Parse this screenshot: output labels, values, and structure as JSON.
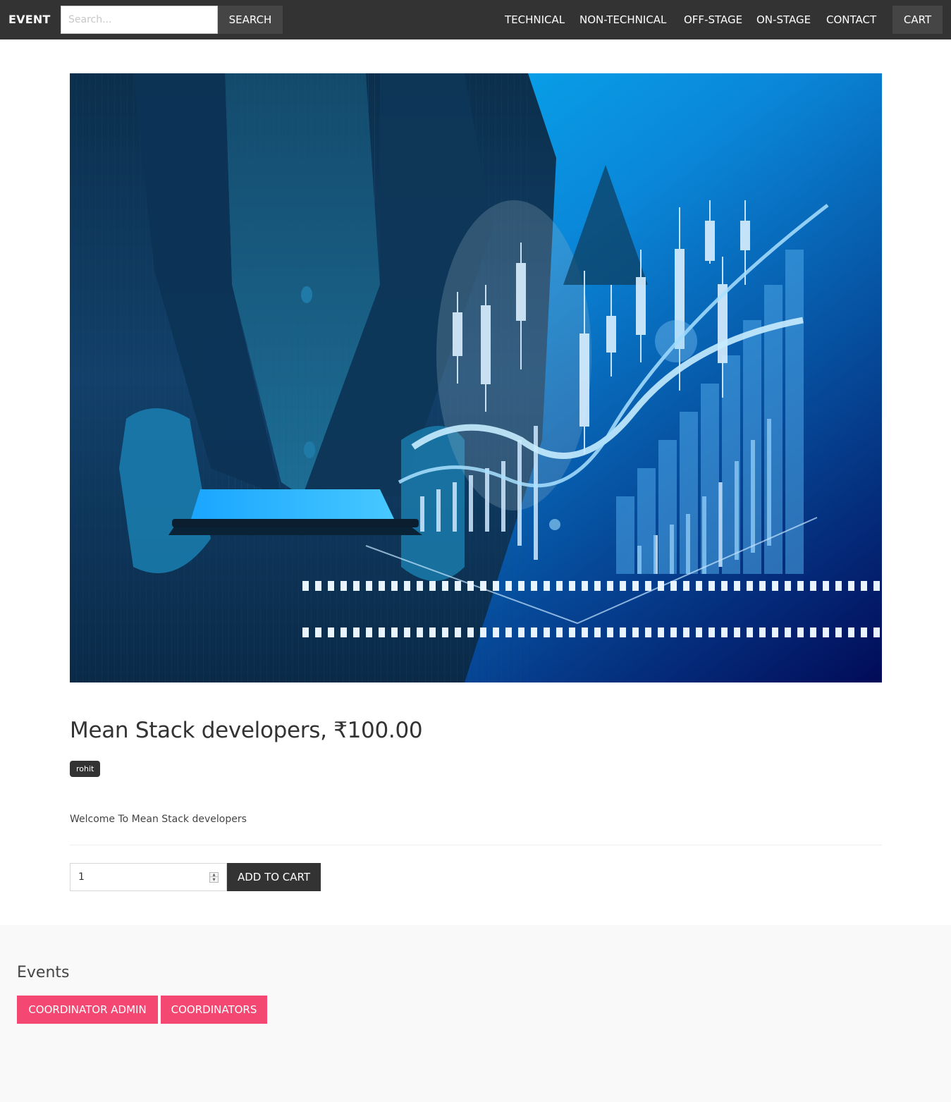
{
  "navbar": {
    "brand": "EVENT",
    "search_placeholder": "Search...",
    "search_label": "SEARCH",
    "links": [
      "TECHNICAL",
      "NON-TECHNICAL",
      "OFF-STAGE",
      "ON-STAGE",
      "CONTACT"
    ],
    "cart_label": "CART"
  },
  "product": {
    "title": "Mean Stack developers, ₹100.00",
    "tag": "rohit",
    "description": "Welcome To Mean Stack developers",
    "quantity": "1",
    "add_to_cart_label": "ADD TO CART"
  },
  "footer": {
    "title": "Events",
    "buttons": [
      "COORDINATOR ADMIN",
      "COORDINATORS"
    ]
  },
  "colors": {
    "navbar_bg": "#333333",
    "nav_button_bg": "#454545",
    "accent_pink": "#f44771",
    "footer_bg": "#f9f9f9"
  }
}
